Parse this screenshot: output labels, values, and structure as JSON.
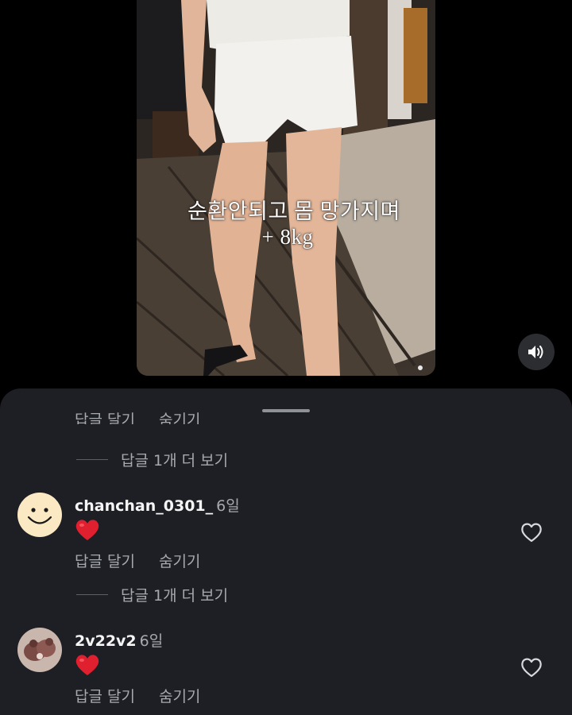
{
  "video": {
    "caption_line1": "순환안되고 몸 망가지며",
    "caption_line2": "+ 8kg"
  },
  "icons": {
    "sound": "speaker-icon",
    "like": "heart-outline-icon",
    "reaction": "red-heart-emoji"
  },
  "colors": {
    "sheet_bg": "#1d1f24",
    "secondary_text": "#a6a9ae",
    "heart_red": "#e0202e"
  },
  "comments_sheet": {
    "cut_actions": {
      "reply": "답글 달기",
      "hide": "숨기기"
    },
    "comments": [
      {
        "username": "chanchan_0301_",
        "time": "6일",
        "body_emoji": "❤️",
        "more_replies": "답글 1개 더 보기",
        "reply_label": "답글 달기",
        "hide_label": "숨기기"
      },
      {
        "username": "2v22v2",
        "time": "6일",
        "body_emoji": "❤️",
        "reply_label": "답글 달기",
        "hide_label": "숨기기"
      }
    ],
    "top_more_replies": "답글 1개 더 보기"
  }
}
